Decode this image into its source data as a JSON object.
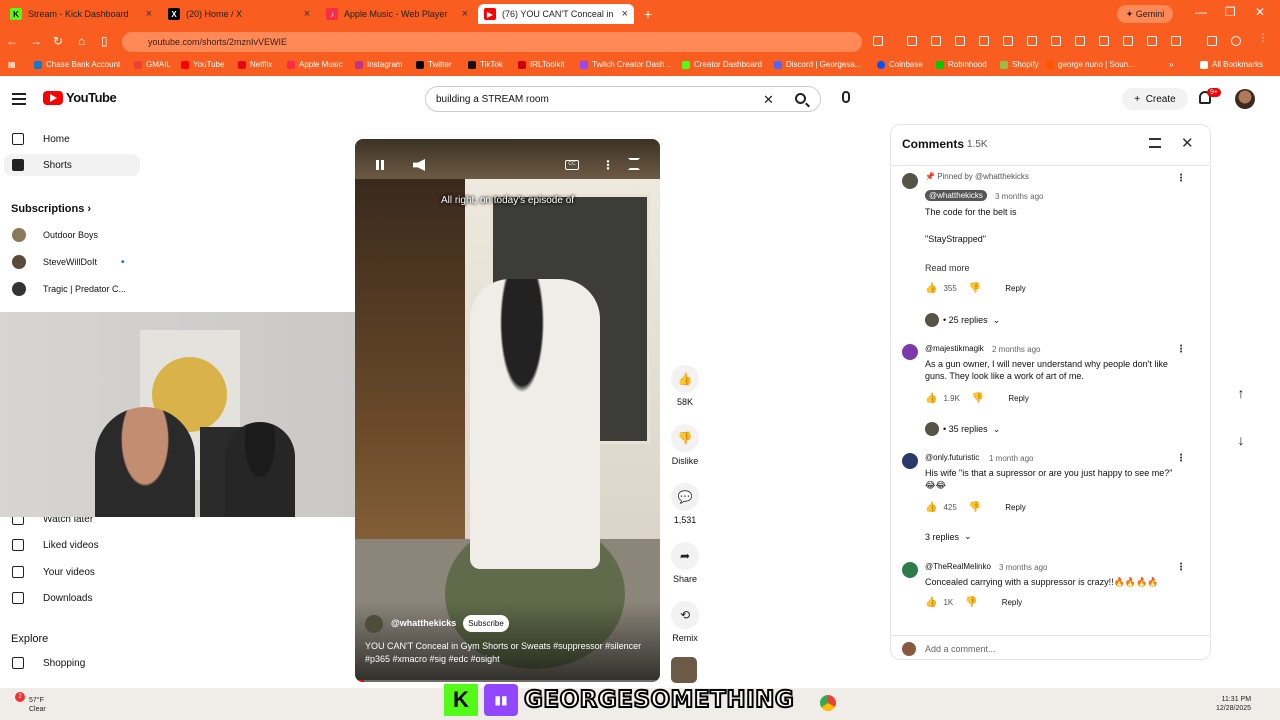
{
  "browser": {
    "tabs": [
      {
        "title": "Stream - Kick Dashboard",
        "icon": "kick-icon",
        "color": "#53fc18"
      },
      {
        "title": "(20) Home / X",
        "icon": "x-icon",
        "color": "#000000"
      },
      {
        "title": "Apple Music - Web Player",
        "icon": "apple-music-icon",
        "color": "#fa2d48"
      },
      {
        "title": "(76) YOU CAN'T Conceal in",
        "icon": "youtube-icon",
        "color": "#ff0000"
      }
    ],
    "gemini_label": "Gemini",
    "url": "youtube.com/shorts/2mznIvVEWIE",
    "bookmarks": [
      "Chase Bank Account",
      "GMAIL",
      "YouTube",
      "Netflix",
      "Apple Music",
      "Instagram",
      "Twitter",
      "TikTok",
      "IRLToolkit",
      "Twitch Creator Dash...",
      "Creator Dashboard",
      "Discord | Georgesa...",
      "Coinbase",
      "Robinhood",
      "Shopify",
      "george nuno | Soun..."
    ],
    "all_bookmarks": "All Bookmarks",
    "accent": "#f95d1f"
  },
  "youtube": {
    "logo_text": "YouTube",
    "search_value": "building a STREAM room",
    "create_label": "Create",
    "notif_badge": "9+"
  },
  "sidebar": {
    "home": "Home",
    "shorts": "Shorts",
    "subscriptions": "Subscriptions",
    "subs": [
      "Outdoor Boys",
      "SteveWillDoIt",
      "Tragic | Predator C..."
    ],
    "watch_later": "Watch later",
    "liked": "Liked videos",
    "your_videos": "Your videos",
    "downloads": "Downloads",
    "explore": "Explore",
    "shopping": "Shopping"
  },
  "video": {
    "caption": "All right, on today's episode of",
    "channel": "@whatthekicks",
    "subscribe": "Subscribe",
    "title": "YOU CAN'T Conceal in Gym Shorts or Sweats #suppressor #silencer #p365 #xmacro #sig #edc #osight",
    "progress": 0.03
  },
  "actions": {
    "likes": "58K",
    "dislike": "Dislike",
    "comments": "1,531",
    "share": "Share",
    "remix": "Remix"
  },
  "comments_panel": {
    "title": "Comments",
    "count": "1.5K",
    "add_placeholder": "Add a comment...",
    "items": [
      {
        "pinned": "Pinned by @whatthekicks",
        "handle": "@whatthekicks",
        "time": "3 months ago",
        "text1": "The code for the belt is",
        "text2": "\"StayStrapped\"",
        "read_more": "Read more",
        "likes": "355",
        "reply": "Reply",
        "replies": "• 25 replies"
      },
      {
        "handle": "@majestikmagik",
        "time": "2 months ago",
        "text": "As a gun owner, I will never understand why people don't like guns. They look like a work of art of me.",
        "likes": "1.9K",
        "reply": "Reply",
        "replies": "• 35 replies"
      },
      {
        "handle": "@only.futuristic",
        "time": "1 month ago",
        "text": "His wife \"is that a supressor or are you just happy to see me?\" 😂😂",
        "likes": "425",
        "reply": "Reply",
        "replies": "3 replies"
      },
      {
        "handle": "@TheRealMelinko",
        "time": "3 months ago",
        "text": "Concealed carrying with a suppressor is crazy!!🔥🔥🔥🔥",
        "likes": "1K",
        "reply": "Reply"
      }
    ]
  },
  "taskbar": {
    "temp": "57°F",
    "condition": "Clear",
    "weather_badge": "2",
    "time": "11:31 PM",
    "date": "12/28/2025",
    "banner_name": "GEORGESOMETHING",
    "banner_k": "K"
  }
}
